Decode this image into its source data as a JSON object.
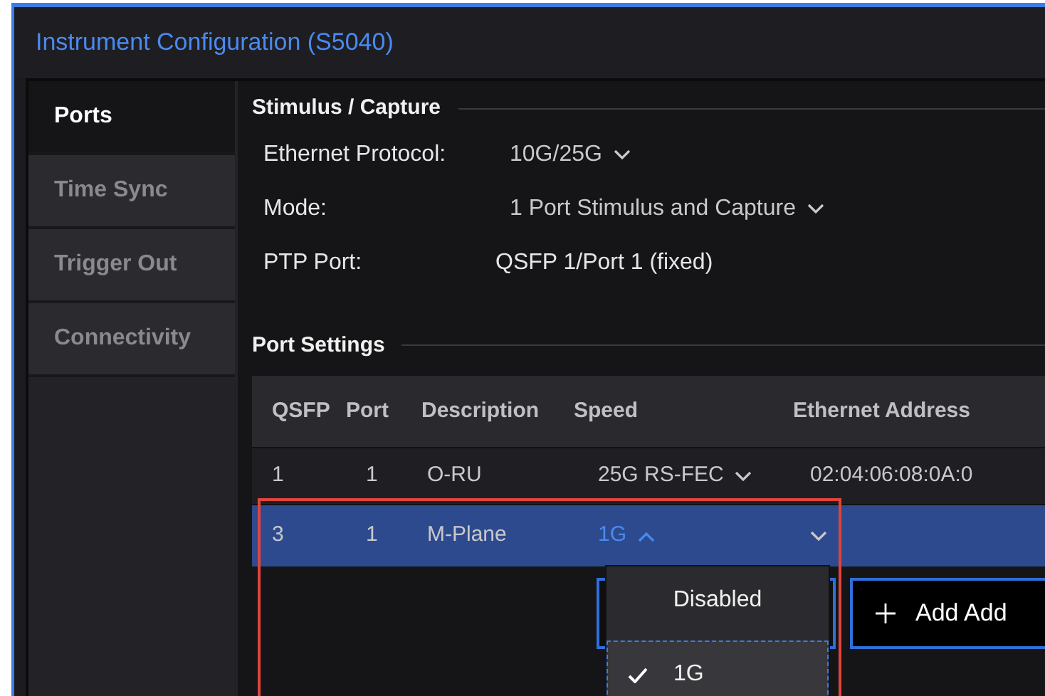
{
  "window": {
    "title": "Instrument Configuration (S5040)"
  },
  "sidebar": {
    "items": [
      {
        "label": "Ports",
        "selected": true
      },
      {
        "label": "Time Sync",
        "selected": false
      },
      {
        "label": "Trigger Out",
        "selected": false
      },
      {
        "label": "Connectivity",
        "selected": false
      }
    ]
  },
  "stimulus_capture": {
    "heading": "Stimulus / Capture",
    "fields": [
      {
        "label": "Ethernet Protocol:",
        "value": "10G/25G",
        "kind": "dropdown"
      },
      {
        "label": "Mode:",
        "value": "1 Port Stimulus and Capture",
        "kind": "dropdown"
      },
      {
        "label": "PTP Port:",
        "value": "QSFP 1/Port 1 (fixed)",
        "kind": "static"
      }
    ]
  },
  "port_settings": {
    "heading": "Port Settings",
    "table": {
      "columns": [
        "QSFP",
        "Port",
        "Description",
        "Speed",
        "Ethernet Address"
      ],
      "rows": [
        {
          "cells": [
            "1",
            "1",
            "O-RU"
          ],
          "speed": "25G RS-FEC",
          "expanded": false,
          "address": "02:04:06:08:0A:0",
          "selected": false
        },
        {
          "cells": [
            "3",
            "1",
            "M-Plane"
          ],
          "speed": "1G",
          "expanded": true,
          "selected": true
        }
      ]
    },
    "add_button": {
      "label": "Add Add"
    }
  },
  "speed_menu": {
    "items": [
      {
        "label": "Disabled",
        "selected": false
      },
      {
        "label": "1G",
        "selected": true
      }
    ]
  }
}
